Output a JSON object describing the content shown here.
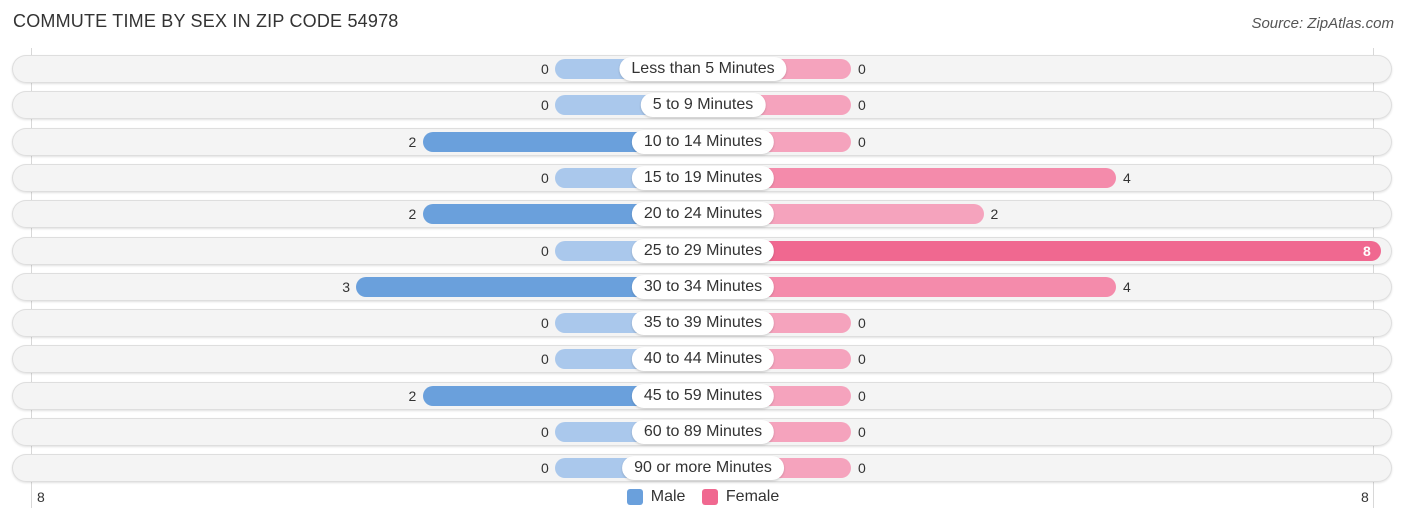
{
  "header": {
    "title": "COMMUTE TIME BY SEX IN ZIP CODE 54978",
    "source": "Source: ZipAtlas.com"
  },
  "colors": {
    "male": "#6aa0dc",
    "male_light": "#aac8ec",
    "female": "#f06890",
    "female_light": "#f5a3bd",
    "female_mid": "#f48bab"
  },
  "chart_data": {
    "type": "bar",
    "orientation": "horizontal-diverging",
    "title": "COMMUTE TIME BY SEX IN ZIP CODE 54978",
    "categories": [
      "Less than 5 Minutes",
      "5 to 9 Minutes",
      "10 to 14 Minutes",
      "15 to 19 Minutes",
      "20 to 24 Minutes",
      "25 to 29 Minutes",
      "30 to 34 Minutes",
      "35 to 39 Minutes",
      "40 to 44 Minutes",
      "45 to 59 Minutes",
      "60 to 89 Minutes",
      "90 or more Minutes"
    ],
    "series": [
      {
        "name": "Male",
        "values": [
          0,
          0,
          2,
          0,
          2,
          0,
          3,
          0,
          0,
          2,
          0,
          0
        ]
      },
      {
        "name": "Female",
        "values": [
          0,
          0,
          0,
          4,
          2,
          8,
          4,
          0,
          0,
          0,
          0,
          0
        ]
      }
    ],
    "axis": {
      "left_label": "8",
      "right_label": "8",
      "max": 8
    },
    "legend": {
      "position": "bottom-center",
      "entries": [
        "Male",
        "Female"
      ]
    }
  }
}
